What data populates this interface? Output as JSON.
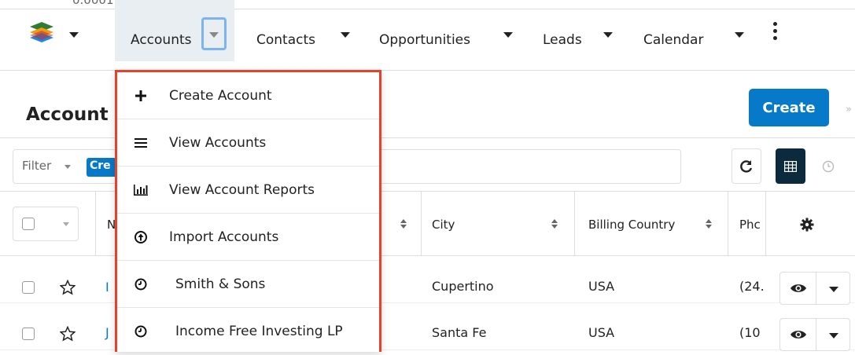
{
  "top_strip": {
    "fragment": "0.0001"
  },
  "navbar": {
    "items": [
      {
        "label": "Accounts"
      },
      {
        "label": "Contacts"
      },
      {
        "label": "Opportunities"
      },
      {
        "label": "Leads"
      },
      {
        "label": "Calendar"
      }
    ]
  },
  "header": {
    "title": "Account",
    "create_label": "Create"
  },
  "filter": {
    "label": "Filter",
    "pill": "Cre"
  },
  "table": {
    "columns": [
      {
        "label": "N"
      },
      {
        "label": "City"
      },
      {
        "label": "Billing Country"
      },
      {
        "label": "Phc"
      }
    ],
    "rows": [
      {
        "name_fragment": "I",
        "city": "Cupertino",
        "country": "USA",
        "phone_fragment": "(24."
      },
      {
        "name_fragment": "J",
        "city": "Santa Fe",
        "country": "USA",
        "phone_fragment": "(10"
      }
    ]
  },
  "dropdown": {
    "items": [
      {
        "label": "Create Account",
        "icon": "plus-icon"
      },
      {
        "label": "View Accounts",
        "icon": "list-icon"
      },
      {
        "label": "View Account Reports",
        "icon": "bar-chart-icon"
      },
      {
        "label": "Import Accounts",
        "icon": "upload-icon"
      },
      {
        "label": "Smith & Sons",
        "icon": "clock-icon"
      },
      {
        "label": "Income Free Investing LP",
        "icon": "clock-icon"
      }
    ]
  },
  "colors": {
    "accent": "#0679c8",
    "highlight_border": "#e8402a",
    "focus_border": "#7cb3f0"
  }
}
